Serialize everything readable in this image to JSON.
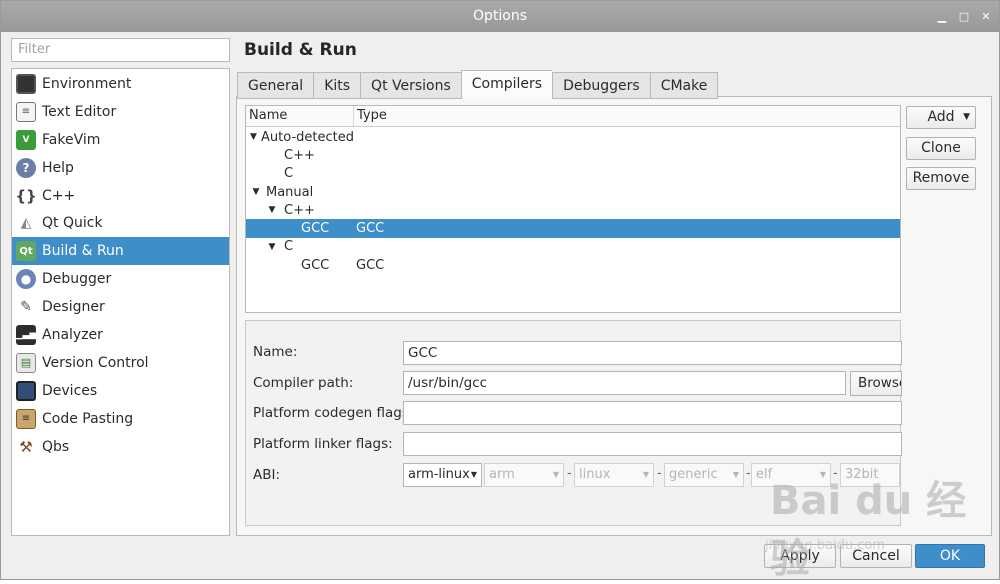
{
  "window": {
    "title": "Options"
  },
  "filter": {
    "placeholder": "Filter"
  },
  "categories": [
    {
      "label": "Environment",
      "icon": "monitor-icon"
    },
    {
      "label": "Text Editor",
      "icon": "text-document-icon"
    },
    {
      "label": "FakeVim",
      "icon": "vim-icon"
    },
    {
      "label": "Help",
      "icon": "help-icon"
    },
    {
      "label": "C++",
      "icon": "braces-icon"
    },
    {
      "label": "Qt Quick",
      "icon": "qt-quick-icon"
    },
    {
      "label": "Build & Run",
      "icon": "qt-build-icon",
      "selected": true
    },
    {
      "label": "Debugger",
      "icon": "debugger-icon"
    },
    {
      "label": "Designer",
      "icon": "designer-icon"
    },
    {
      "label": "Analyzer",
      "icon": "analyzer-icon"
    },
    {
      "label": "Version Control",
      "icon": "version-control-icon"
    },
    {
      "label": "Devices",
      "icon": "device-icon"
    },
    {
      "label": "Code Pasting",
      "icon": "clipboard-icon"
    },
    {
      "label": "Qbs",
      "icon": "hammer-icon"
    }
  ],
  "page": {
    "title": "Build & Run"
  },
  "tabs": [
    {
      "label": "General"
    },
    {
      "label": "Kits"
    },
    {
      "label": "Qt Versions"
    },
    {
      "label": "Compilers",
      "active": true
    },
    {
      "label": "Debuggers"
    },
    {
      "label": "CMake"
    }
  ],
  "tree": {
    "columns": {
      "name": "Name",
      "type": "Type"
    },
    "rows": [
      {
        "name": "Auto-detected",
        "type": "",
        "indent": 0,
        "expander": true
      },
      {
        "name": "C++",
        "type": "",
        "indent": 1,
        "expander": false
      },
      {
        "name": "C",
        "type": "",
        "indent": 1,
        "expander": false
      },
      {
        "name": "Manual",
        "type": "",
        "indent": 0,
        "expander": true
      },
      {
        "name": "C++",
        "type": "",
        "indent": 1,
        "expander": true
      },
      {
        "name": "GCC",
        "type": "GCC",
        "indent": 2,
        "expander": false,
        "selected": true
      },
      {
        "name": "C",
        "type": "",
        "indent": 1,
        "expander": true
      },
      {
        "name": "GCC",
        "type": "GCC",
        "indent": 2,
        "expander": false
      }
    ]
  },
  "buttons": {
    "add": "Add",
    "clone": "Clone",
    "remove": "Remove"
  },
  "form": {
    "name_label": "Name:",
    "name_value": "GCC",
    "path_label": "Compiler path:",
    "path_value": "/usr/bin/gcc",
    "browse": "Browse...",
    "codegen_label": "Platform codegen flags:",
    "codegen_value": "",
    "linker_label": "Platform linker flags:",
    "linker_value": "",
    "abi_label": "ABI:",
    "abi": [
      "arm-linux",
      "arm",
      "linux",
      "generic",
      "elf",
      "32bit"
    ],
    "abi_sep": "-"
  },
  "footer": {
    "apply": "Apply",
    "cancel": "Cancel",
    "ok": "OK"
  },
  "watermark": {
    "logo": "Bai du 经验",
    "url": "jingyan.baidu.com"
  }
}
